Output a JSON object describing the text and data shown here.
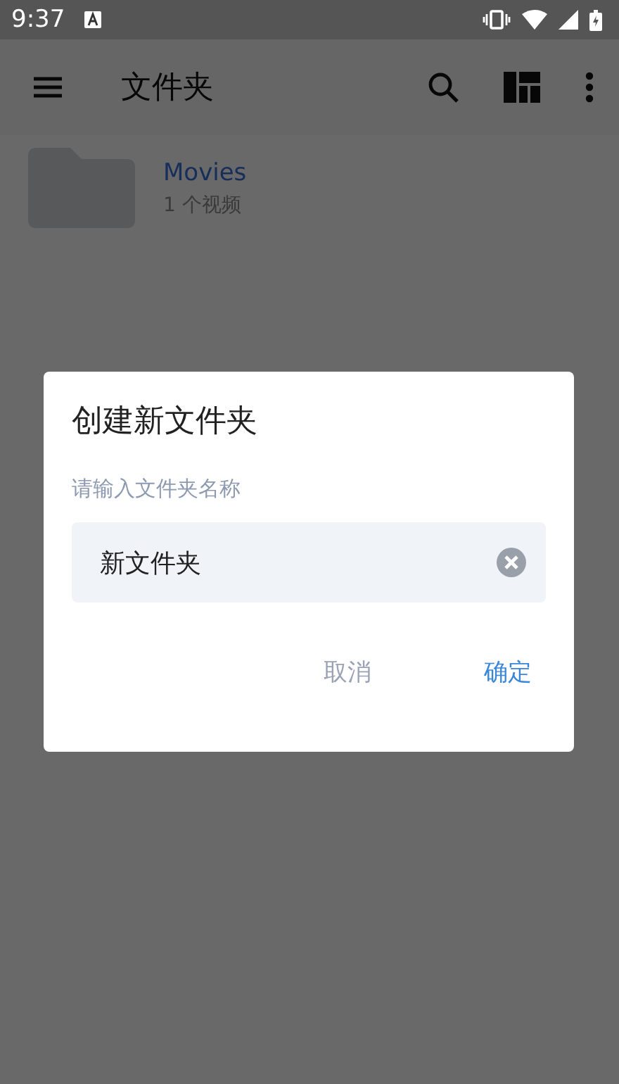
{
  "status_bar": {
    "time": "9:37"
  },
  "app_bar": {
    "title": "文件夹"
  },
  "folders": [
    {
      "name": "Movies",
      "count": "1 个视频"
    }
  ],
  "dialog": {
    "title": "创建新文件夹",
    "field": {
      "label": "请输入文件夹名称",
      "value": "新文件夹"
    },
    "buttons": [
      {
        "label": "取消",
        "kind": "cancel"
      },
      {
        "label": "确定",
        "kind": "confirm"
      }
    ]
  }
}
